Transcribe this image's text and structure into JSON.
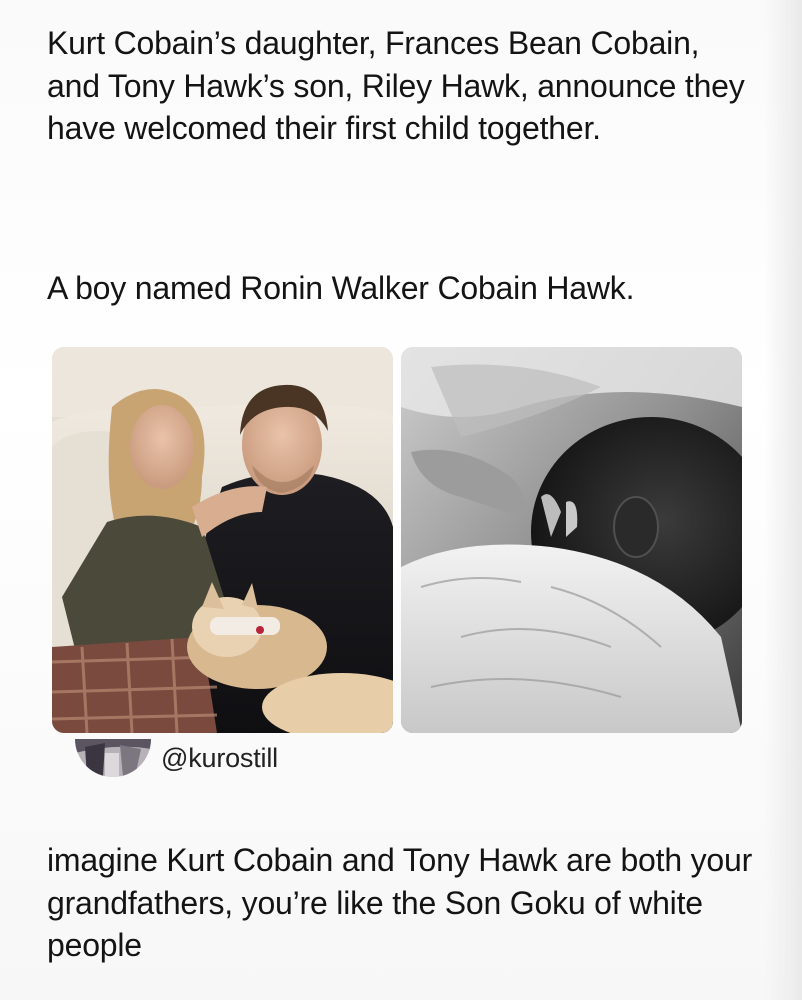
{
  "post": {
    "text_line1": "Kurt Cobain’s daughter, Frances Bean Cobain, and Tony Hawk’s son, Riley Hawk, announce they have welcomed their first child together.",
    "text_line2": "A boy named Ronin Walker Cobain Hawk."
  },
  "media": {
    "photos": [
      {
        "name": "couple-photo"
      },
      {
        "name": "baby-photo"
      }
    ]
  },
  "reply": {
    "handle": "@kurostill",
    "text": "imagine Kurt Cobain and Tony Hawk are both your grandfathers, you’re like the Son Goku of white people"
  }
}
